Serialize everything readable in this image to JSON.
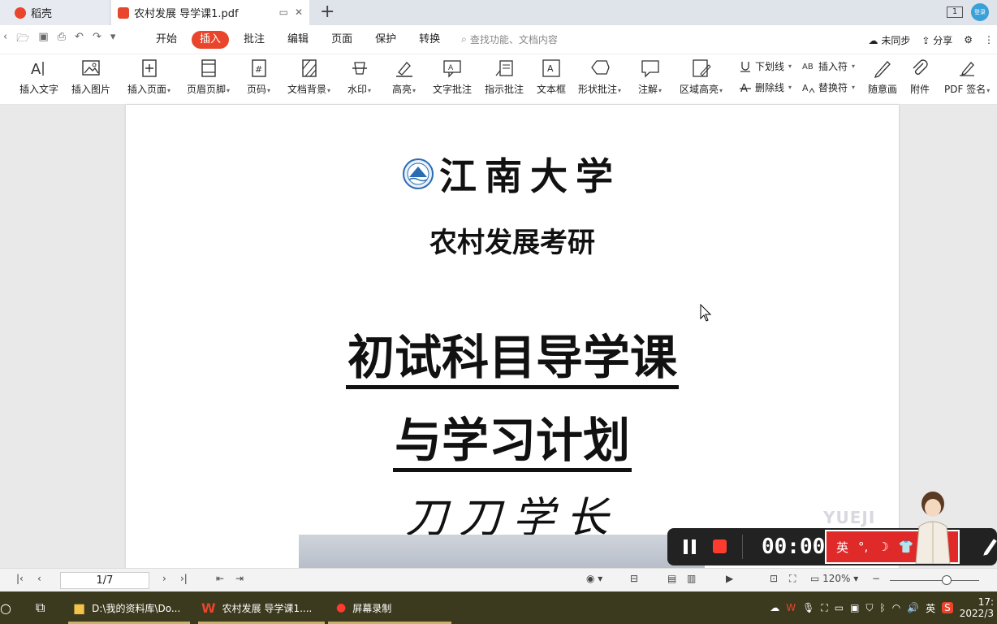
{
  "tabs": [
    {
      "label": "稻壳",
      "color": "#e8452c"
    },
    {
      "label": "农村发展 导学课1.pdf",
      "color": "#e8452c"
    }
  ],
  "toolbar_top": {
    "page_count_badge": "1",
    "avatar_text": "登录"
  },
  "menu": {
    "items": [
      "开始",
      "插入",
      "批注",
      "编辑",
      "页面",
      "保护",
      "转换"
    ],
    "active": "插入",
    "search_placeholder": "查找功能、文档内容",
    "sync": "未同步",
    "share": "分享"
  },
  "ribbon": {
    "buttons": [
      {
        "label": "插入文字",
        "icon": "text-insert-icon"
      },
      {
        "label": "插入图片",
        "icon": "image-insert-icon"
      },
      {
        "label": "插入页面",
        "icon": "page-insert-icon",
        "dropdown": true
      },
      {
        "label": "页眉页脚",
        "icon": "header-footer-icon",
        "dropdown": true
      },
      {
        "label": "页码",
        "icon": "page-number-icon",
        "dropdown": true
      },
      {
        "label": "文档背景",
        "icon": "background-icon",
        "dropdown": true
      },
      {
        "label": "水印",
        "icon": "watermark-icon",
        "dropdown": true
      },
      {
        "label": "高亮",
        "icon": "highlight-icon",
        "dropdown": true
      },
      {
        "label": "文字批注",
        "icon": "text-comment-icon"
      },
      {
        "label": "指示批注",
        "icon": "pointer-comment-icon"
      },
      {
        "label": "文本框",
        "icon": "textbox-icon"
      },
      {
        "label": "形状批注",
        "icon": "shape-comment-icon",
        "dropdown": true
      },
      {
        "label": "注解",
        "icon": "annotation-icon",
        "dropdown": true
      },
      {
        "label": "区域高亮",
        "icon": "area-highlight-icon",
        "dropdown": true
      },
      {
        "label": "随意画",
        "icon": "freehand-icon"
      },
      {
        "label": "附件",
        "icon": "attachment-icon"
      },
      {
        "label": "PDF 签名",
        "icon": "pdf-sign-icon",
        "dropdown": true
      }
    ],
    "small_buttons": [
      {
        "label": "下划线",
        "icon": "underline-icon"
      },
      {
        "label": "删除线",
        "icon": "strikethrough-icon"
      },
      {
        "label": "插入符",
        "icon": "insert-caret-icon"
      },
      {
        "label": "替换符",
        "icon": "replace-caret-icon"
      }
    ]
  },
  "document": {
    "university": "江南大学",
    "subtitle": "农村发展考研",
    "title_line1": "初试科目导学课",
    "title_line2": "与学习计划",
    "author": "刀刀学长"
  },
  "recorder": {
    "time": "00:00:0"
  },
  "ime": {
    "lang": "英"
  },
  "overlay_watermark": "YUEJI",
  "statusbar": {
    "page": "1/7",
    "zoom": "120%"
  },
  "taskbar": {
    "items": [
      {
        "label": "D:\\我的资料库\\Do..."
      },
      {
        "label": "农村发展 导学课1...."
      },
      {
        "label": "屏幕录制"
      }
    ],
    "tray_lang": "英",
    "clock_time": "17:",
    "clock_date": "2022/3"
  },
  "colors": {
    "accent": "#e8452c",
    "taskbar": "#3c3a1e",
    "recorder_stop": "#ff3b30"
  }
}
